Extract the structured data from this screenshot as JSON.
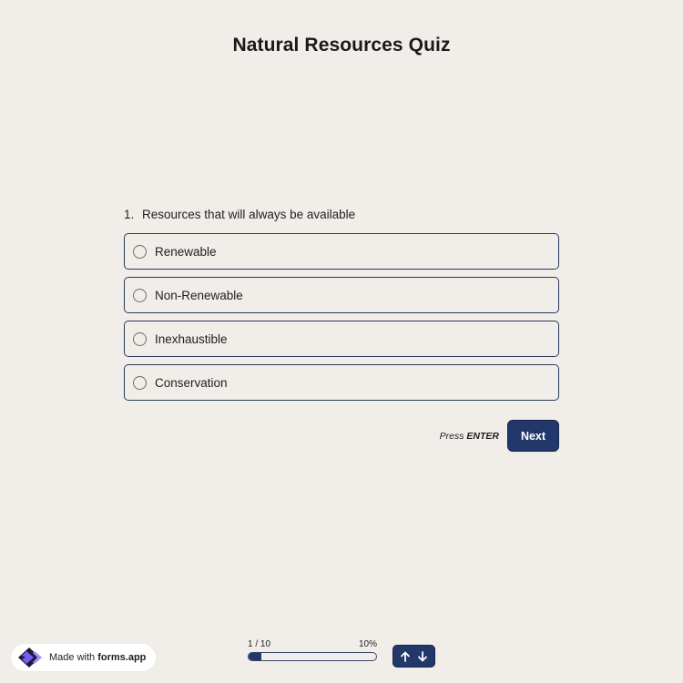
{
  "form": {
    "title": "Natural Resources Quiz"
  },
  "question": {
    "number": "1.",
    "text": "Resources that will always be available",
    "options": [
      {
        "label": "Renewable"
      },
      {
        "label": "Non-Renewable"
      },
      {
        "label": "Inexhaustible"
      },
      {
        "label": "Conservation"
      }
    ]
  },
  "actions": {
    "press_prefix": "Press",
    "press_key": "ENTER",
    "next_label": "Next"
  },
  "footer": {
    "badge_prefix": "Made with",
    "badge_brand": "forms.app",
    "progress_count": "1 / 10",
    "progress_percent": "10%",
    "progress_fraction": 0.1,
    "nav_up_icon": "arrow-up-icon",
    "nav_down_icon": "arrow-down-icon"
  },
  "colors": {
    "background": "#f1eee9",
    "accent": "#22386b",
    "option_border": "#2b3a5c",
    "logo_purple": "#7b5cf5"
  }
}
